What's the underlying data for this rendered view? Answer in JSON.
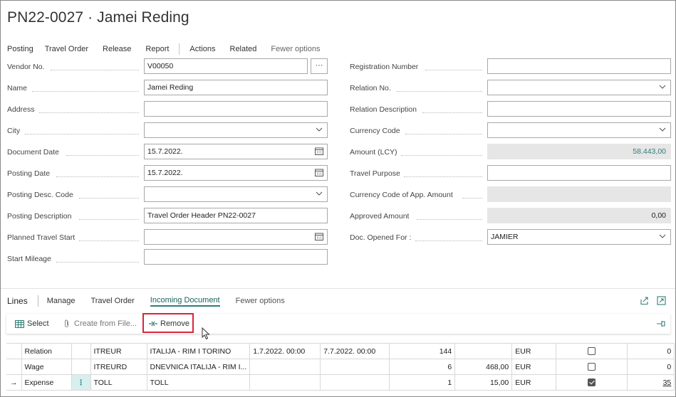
{
  "page": {
    "title": "PN22-0027 · Jamei Reding"
  },
  "actions": [
    "Posting",
    "Travel Order",
    "Release",
    "Report",
    "Actions",
    "Related",
    "Fewer options"
  ],
  "left_fields": [
    {
      "label": "Vendor No.",
      "value": "V00050",
      "control": "lookup"
    },
    {
      "label": "Name",
      "value": "Jamei Reding",
      "control": "text"
    },
    {
      "label": "Address",
      "value": "",
      "control": "text"
    },
    {
      "label": "City",
      "value": "",
      "control": "select"
    },
    {
      "label": "Document Date",
      "value": "15.7.2022.",
      "control": "date"
    },
    {
      "label": "Posting Date",
      "value": "15.7.2022.",
      "control": "date"
    },
    {
      "label": "Posting Desc. Code",
      "value": "",
      "control": "select"
    },
    {
      "label": "Posting Description",
      "value": "Travel Order Header PN22-0027",
      "control": "text"
    },
    {
      "label": "Planned Travel Start",
      "value": "",
      "control": "date"
    },
    {
      "label": "Start Mileage",
      "value": "",
      "control": "text"
    }
  ],
  "right_fields": [
    {
      "label": "Registration Number",
      "value": "",
      "control": "text"
    },
    {
      "label": "Relation No.",
      "value": "",
      "control": "select"
    },
    {
      "label": "Relation Description",
      "value": "",
      "control": "text"
    },
    {
      "label": "Currency Code",
      "value": "",
      "control": "select"
    },
    {
      "label": "Amount (LCY)",
      "value": "58.443,00",
      "control": "readonly-teal"
    },
    {
      "label": "Travel Purpose",
      "value": "",
      "control": "text"
    },
    {
      "label": "Currency Code of App. Amount",
      "value": "",
      "control": "readonly"
    },
    {
      "label": "Approved Amount",
      "value": "0,00",
      "control": "readonly"
    },
    {
      "label": "Doc. Opened For :",
      "value": "JAMIER",
      "control": "select"
    }
  ],
  "lines": {
    "title": "Lines",
    "tabs": [
      "Manage",
      "Travel Order",
      "Incoming Document",
      "Fewer options"
    ],
    "active_tab": "Incoming Document",
    "toolbar": {
      "select": "Select",
      "create": "Create from File...",
      "remove": "Remove"
    },
    "rows": [
      {
        "indicator": "",
        "type": "Relation",
        "menu": "",
        "no": "ITREUR",
        "description": "ITALIJA - RIM I TORINO",
        "start": "1.7.2022. 00:00",
        "end": "7.7.2022. 00:00",
        "qty": "144",
        "amount": "",
        "currency": "EUR",
        "paid": false,
        "entry": "0"
      },
      {
        "indicator": "",
        "type": "Wage",
        "menu": "",
        "no": "ITREURD",
        "description": "DNEVNICA ITALIJA - RIM I...",
        "start": "",
        "end": "",
        "qty": "6",
        "amount": "468,00",
        "currency": "EUR",
        "paid": false,
        "entry": "0"
      },
      {
        "indicator": "→",
        "type": "Expense",
        "menu": "⋮",
        "no": "TOLL",
        "description": "TOLL",
        "start": "",
        "end": "",
        "qty": "1",
        "amount": "15,00",
        "currency": "EUR",
        "paid": true,
        "entry": "35"
      }
    ]
  },
  "colors": {
    "accent": "#2f7d78",
    "highlight": "#d7263d"
  }
}
